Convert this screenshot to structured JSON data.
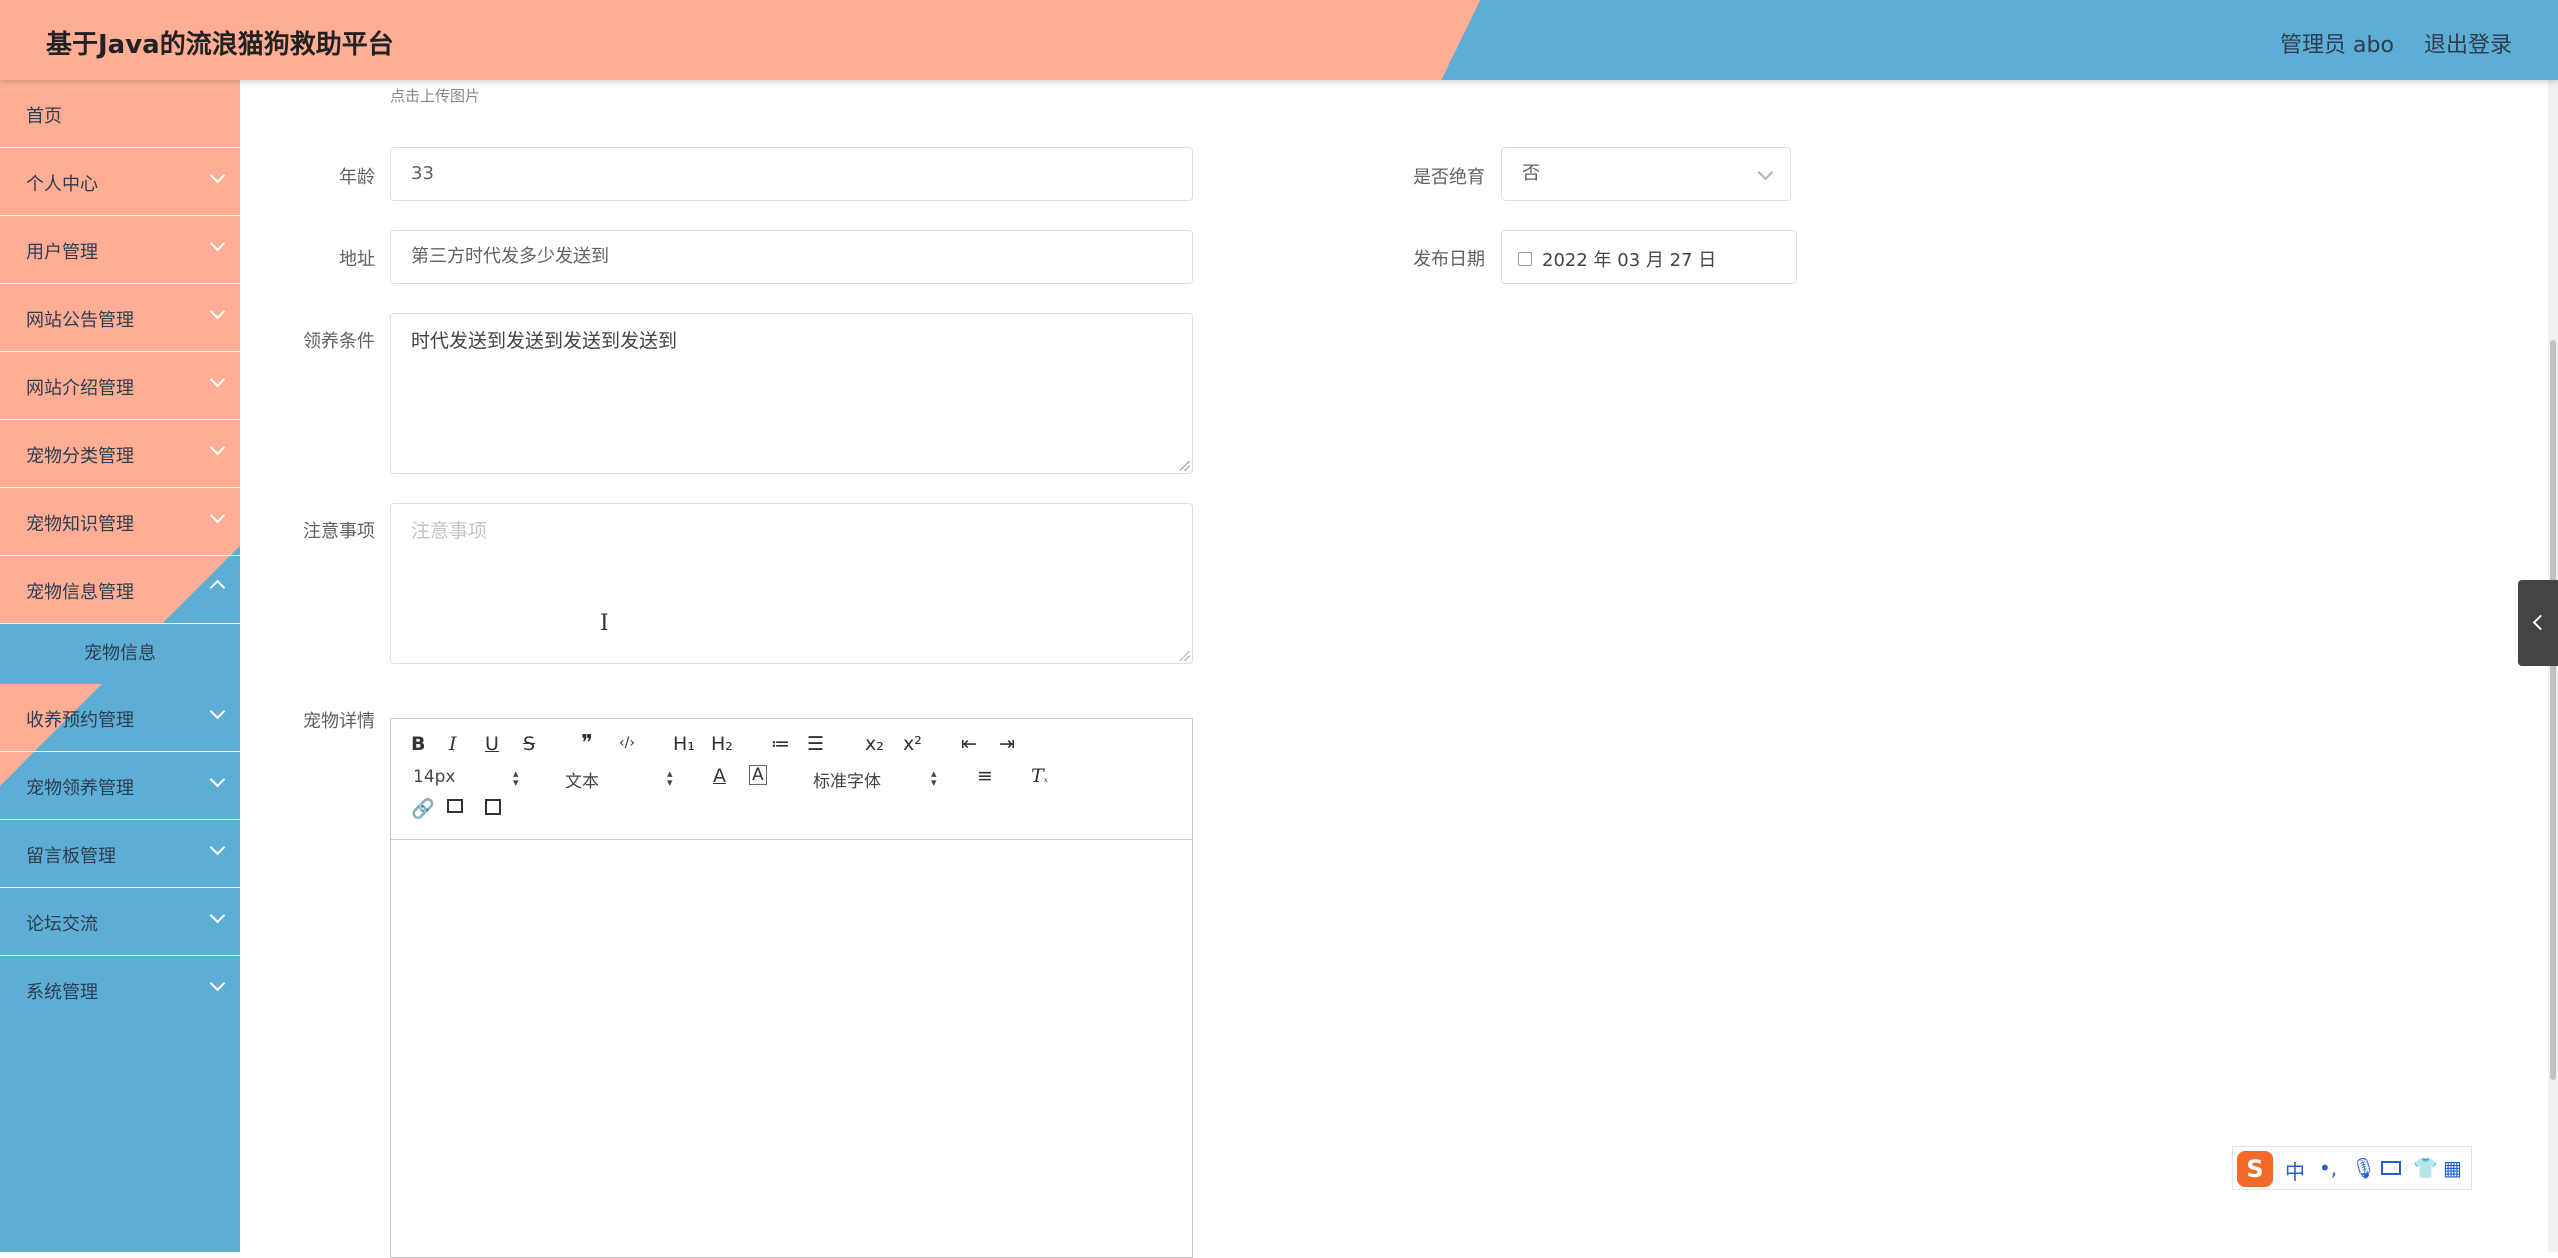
{
  "header": {
    "title": "基于Java的流浪猫狗救助平台",
    "user": "管理员 abo",
    "logout": "退出登录"
  },
  "sidebar": {
    "items": [
      {
        "label": "首页",
        "has_chevron": false
      },
      {
        "label": "个人中心",
        "has_chevron": true
      },
      {
        "label": "用户管理",
        "has_chevron": true
      },
      {
        "label": "网站公告管理",
        "has_chevron": true
      },
      {
        "label": "网站介绍管理",
        "has_chevron": true
      },
      {
        "label": "宠物分类管理",
        "has_chevron": true
      },
      {
        "label": "宠物知识管理",
        "has_chevron": true
      },
      {
        "label": "宠物信息管理",
        "has_chevron": true
      },
      {
        "label": "宠物信息",
        "sub": true
      },
      {
        "label": "收养预约管理",
        "has_chevron": true
      },
      {
        "label": "宠物领养管理",
        "has_chevron": true
      },
      {
        "label": "留言板管理",
        "has_chevron": true
      },
      {
        "label": "论坛交流",
        "has_chevron": true
      },
      {
        "label": "系统管理",
        "has_chevron": true
      }
    ],
    "active_bg": "#5eadd4"
  },
  "form": {
    "upload_hint": "点击上传图片",
    "age": {
      "label": "年龄",
      "value": "33"
    },
    "address": {
      "label": "地址",
      "value": "第三方时代发多少发送到"
    },
    "neutered": {
      "label": "是否绝育",
      "value": "否"
    },
    "publish_date": {
      "label": "发布日期",
      "value": "2022 年 03 月 27 日"
    },
    "adopt_conditions": {
      "label": "领养条件",
      "value": "时代发送到发送到发送到发送到"
    },
    "notes": {
      "label": "注意事项",
      "placeholder": "注意事项"
    },
    "details": {
      "label": "宠物详情"
    }
  },
  "editor": {
    "buttons_row1": [
      "B",
      "I",
      "U",
      "S",
      "❞",
      "‹/›",
      "H₁",
      "H₂",
      "≔",
      "☰",
      "x₂",
      "x²",
      "⇤",
      "⇥"
    ],
    "font_size": "14px",
    "text_type": "文本",
    "font_family": "标准字体",
    "color_icon": "A"
  },
  "ime": {
    "logo": "S",
    "lang": "中",
    "punct": "•,"
  },
  "colors": {
    "header_salmon": "#ffae95",
    "header_blue": "#5eadd4"
  }
}
